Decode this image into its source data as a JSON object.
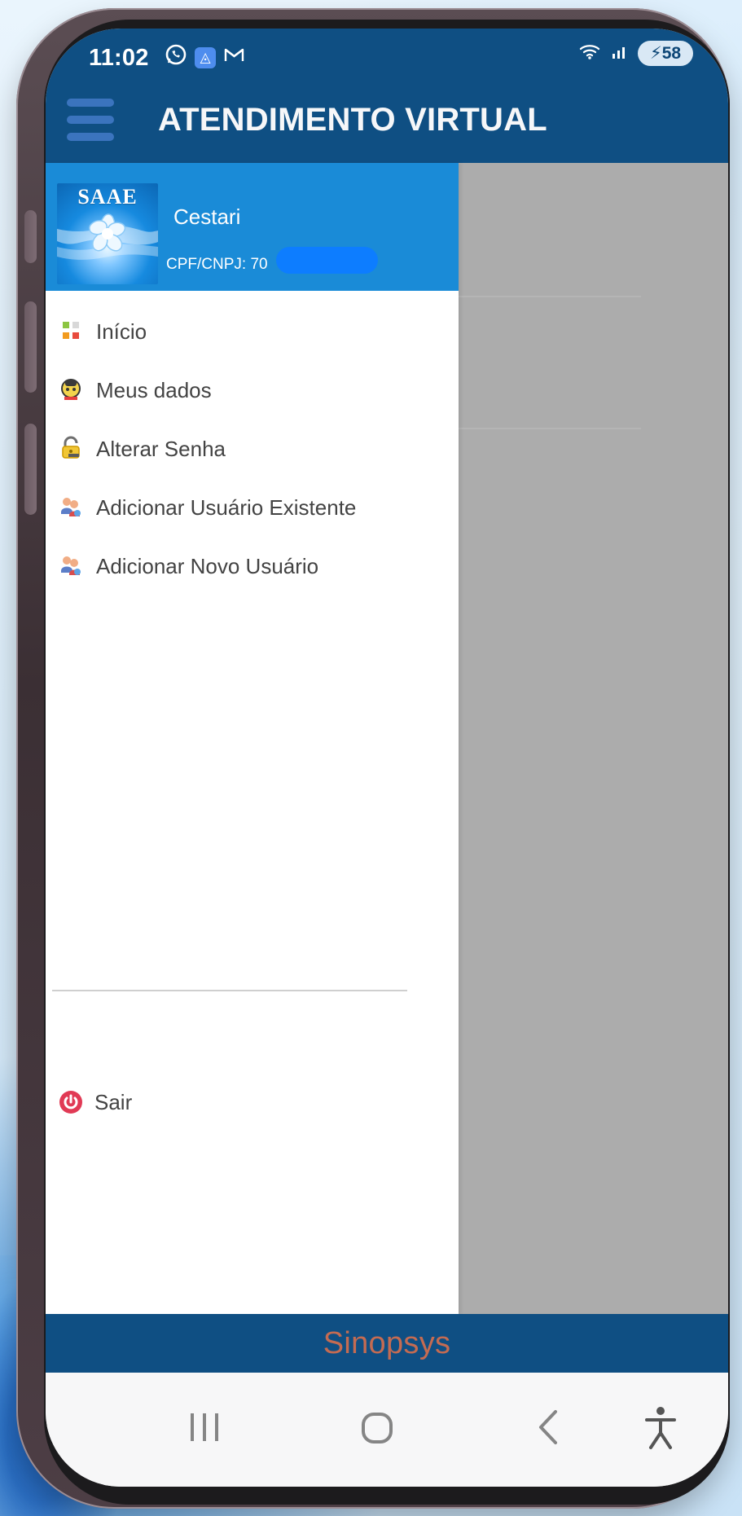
{
  "theme": {
    "header_bg": "#0f4f83",
    "profile_bg": "#1a8bd7",
    "overlay_bg": "#acacac",
    "brand_text": "#c46b52",
    "icon_red": "#e13a55"
  },
  "status_bar": {
    "time": "11:02",
    "battery": "58",
    "left_icons": [
      "whatsapp-icon",
      "app-icon",
      "gmail-icon"
    ],
    "right_icons": [
      "wifi-icon",
      "signal-icon",
      "battery-icon"
    ]
  },
  "header": {
    "title": "ATENDIMENTO VIRTUAL"
  },
  "profile": {
    "logo_text": "SAAE",
    "name": "Cestari",
    "document": "CPF/CNPJ: 70"
  },
  "menu": {
    "items": [
      {
        "label": "Início",
        "icon": "grid-icon"
      },
      {
        "label": "Meus dados",
        "icon": "user-profile-icon"
      },
      {
        "label": "Alterar Senha",
        "icon": "lock-icon"
      },
      {
        "label": "Adicionar Usuário Existente",
        "icon": "users-add-icon"
      },
      {
        "label": "Adicionar Novo Usuário",
        "icon": "users-add-icon"
      }
    ],
    "logout": {
      "label": "Sair",
      "icon": "power-icon"
    }
  },
  "footer": {
    "brand": "Sinopsys"
  }
}
